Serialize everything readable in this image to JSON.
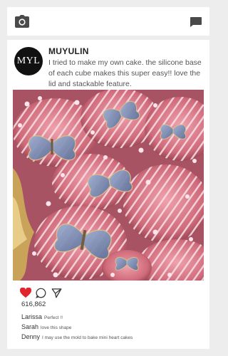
{
  "header": {
    "camera_icon": "camera-icon",
    "message_icon": "message-icon"
  },
  "post": {
    "avatar_text": "MYL",
    "username": "MUYULIN",
    "caption": "I tried to make my own cake. the silicone base of each cube makes this super easy!! love the lid and stackable feature.",
    "like_count": "616,862",
    "liked": true,
    "comments": [
      {
        "user": "Larissa",
        "text": "Perfect !!"
      },
      {
        "user": "Sarah",
        "text": "love this shape"
      },
      {
        "user": "Denny",
        "text": "I may use the mold to bake mini heart cakes"
      }
    ]
  },
  "colors": {
    "background": "#ededed",
    "card": "#ffffff",
    "like_red": "#e0262c",
    "cake_pink": "#d47684",
    "butterfly_blue": "#7f93b8",
    "gold": "#c9a35a"
  }
}
